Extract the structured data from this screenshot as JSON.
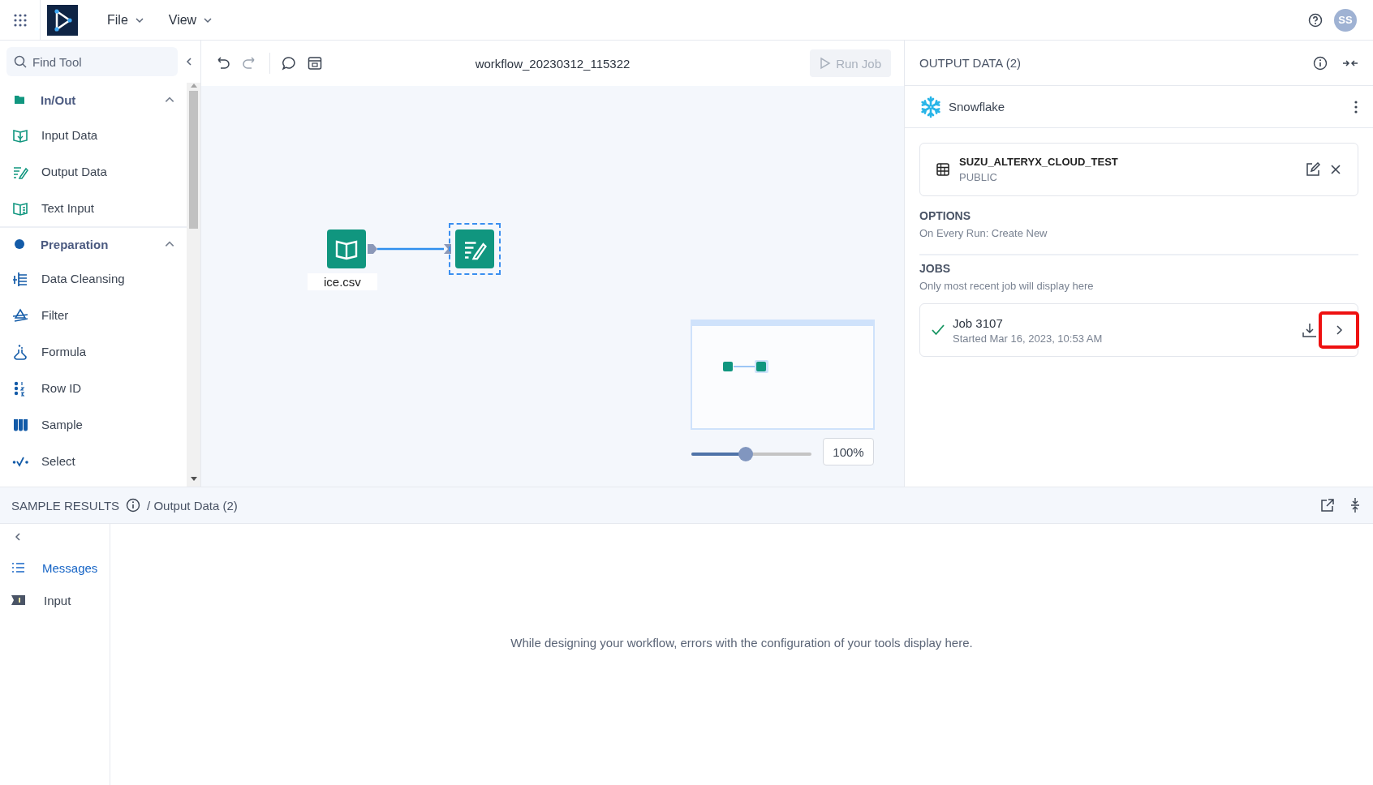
{
  "app_bar": {
    "menus": [
      {
        "label": "File"
      },
      {
        "label": "View"
      }
    ],
    "avatar": "SS"
  },
  "tool_search": {
    "placeholder": "Find Tool"
  },
  "tool_groups": [
    {
      "label": "In/Out",
      "expanded": true,
      "color": "#10967f",
      "children": [
        {
          "label": "Input Data"
        },
        {
          "label": "Output Data"
        },
        {
          "label": "Text Input"
        }
      ]
    },
    {
      "label": "Preparation",
      "expanded": true,
      "color": "#135ba8",
      "children": [
        {
          "label": "Data Cleansing"
        },
        {
          "label": "Filter"
        },
        {
          "label": "Formula"
        },
        {
          "label": "Row ID"
        },
        {
          "label": "Sample"
        },
        {
          "label": "Select"
        }
      ]
    }
  ],
  "workflow": {
    "title": "workflow_20230312_115322",
    "run_button": {
      "label": "Run Job",
      "disabled": true
    }
  },
  "canvas": {
    "nodes": [
      {
        "label": "ice.csv",
        "selected": false
      },
      {
        "selected": true
      }
    ]
  },
  "zoom": {
    "level": 0.45,
    "reading": "100%"
  },
  "output_panel": {
    "title": "OUTPUT DATA (2)",
    "connection": "Snowflake",
    "table": {
      "name": "SUZU_ALTERYX_CLOUD_TEST",
      "schema": "PUBLIC"
    },
    "options": {
      "heading": "OPTIONS",
      "value": "On Every Run: Create New"
    },
    "jobs": {
      "heading": "JOBS",
      "note": "Only most recent job will display here",
      "items": [
        {
          "title": "Job 3107",
          "started": "Started Mar 16, 2023, 10:53 AM",
          "succeeded": true,
          "highlighted": true
        }
      ]
    }
  },
  "sample_results": {
    "title": "SAMPLE RESULTS",
    "path": "/ Output Data (2)",
    "tabs": [
      {
        "label": "Messages",
        "selected": true
      },
      {
        "label": "Input",
        "selected": false
      }
    ],
    "message": "While designing your workflow, errors with the configuration of your tools display here."
  }
}
